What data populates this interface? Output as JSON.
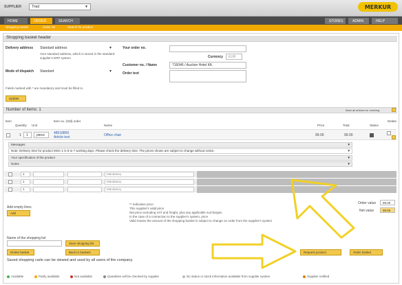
{
  "header": {
    "supplier_label": "SUPPLIER",
    "supplier_value": "Triad",
    "logo_text": "MERKUR"
  },
  "nav": {
    "tabs": [
      {
        "label": "Home"
      },
      {
        "label": "Order"
      },
      {
        "label": "Search"
      }
    ],
    "right": [
      {
        "label": "Stores"
      },
      {
        "label": "Admin"
      },
      {
        "label": "Help"
      }
    ]
  },
  "subnav": {
    "items": [
      "Shopping basket",
      "Order list",
      "Search for product"
    ]
  },
  "basket_header": {
    "title": "Shopping basket header",
    "delivery_address_label": "Delivery address",
    "delivery_address_value": "Standard address",
    "delivery_note": "Your standard address, which is stored in the standard supplier's ERP system",
    "mode_of_dispatch_label": "Mode of dispatch",
    "mode_of_dispatch_value": "Standard",
    "your_order_no_label": "Your order no.",
    "currency_label": "Currency",
    "currency_value": "EUR",
    "customer_no_label": "Customer no. / Name",
    "customer_no_value": "716046 / Auction Hotel Kft.",
    "order_text_label": "Order text",
    "mandatory_note": "Fields marked with * are mandatory and must be filled in.",
    "update_button": "Update"
  },
  "items": {
    "title": "Number of items: 1",
    "right_note": "Mark all articles for ordering",
    "columns": [
      "Item",
      "Quantity",
      "Unit",
      "Item no. (Old) order",
      "Name",
      "Price",
      "Total",
      "Status",
      "Delete"
    ],
    "row": {
      "item": "1",
      "quantity": "1",
      "unit": "piece",
      "item_no": "48518800",
      "item_no_sub": "Article text",
      "name": "Office chair",
      "price": "99.00",
      "total": "99.00"
    },
    "sub_rows": [
      "Messages",
      "Note: Delivery time for product MSC-1 is 5 to 7 working days. Please check the delivery time. The prices shown are subject to change without notice.",
      "Your specification of the product",
      "Notes"
    ],
    "blank_rows": [
      {
        "qty": "1",
        "name": "Mandatory"
      },
      {
        "qty": "1",
        "name": "Mandatory"
      },
      {
        "qty": "1",
        "name": "Mandatory"
      }
    ]
  },
  "footer": {
    "add_lines_label": "Add empty lines",
    "add_button": "Add",
    "info_lines": [
      "** Indicative price",
      "This supplier's valid price",
      "Net price excluding VAT and freight, plus any applicable surcharges",
      "In the case of a connection to the supplier's system, price",
      "Valid means the amount of the shopping basket is subject to change on order from the supplier's system"
    ],
    "order_value_label": "Order value",
    "order_value": "99.00",
    "net_value_label": "Net value",
    "net_value": "99.00",
    "save_label": "Name of the shopping list",
    "save_button": "Save shopping list",
    "delete_button": "Delete basket",
    "back_button": "Back to baskets",
    "request_button": "Request product",
    "order_button": "Order basket",
    "visibility_note": "Saved shopping carts can be viewed and used by all users of the company."
  },
  "legend": [
    {
      "label": "Available",
      "color": "#4caf50"
    },
    {
      "label": "Partly available",
      "color": "#f2a900"
    },
    {
      "label": "Not available",
      "color": "#d0312d"
    },
    {
      "label": "Quantities will be checked by supplier",
      "color": "#888888"
    },
    {
      "label": "No status or stock information available from supplier system",
      "color": "#bbbbbb"
    },
    {
      "label": "Supplier notified",
      "color": "#e07b00"
    }
  ],
  "colors": {
    "accent": "#f2a900",
    "dark_nav": "#4b4b4b",
    "arrow": "#f2d024"
  }
}
